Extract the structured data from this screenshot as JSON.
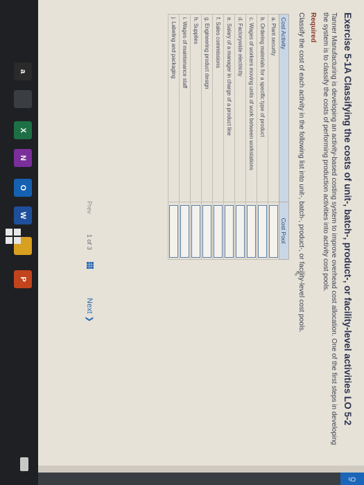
{
  "exercise": {
    "title": "Exercise 5-1A Classifying the costs of unit-, batch-, product-, or facility-level activities LO 5-2",
    "intro": "Tanner Manufacturing is developing an activity-based costing system to improve overhead cost allocation. One of the first steps in developing the system is to classify the costs of performing production activities into activity cost pools.",
    "required_label": "Required",
    "instruction": "Classify the cost of each activity in the following list into unit-, batch-, product-, or facility-level cost pools."
  },
  "table": {
    "headers": [
      "Cost Activity",
      "Cost Pool"
    ],
    "rows": [
      {
        "letter": "a.",
        "activity": "Plant security"
      },
      {
        "letter": "b.",
        "activity": "Ordering materials for a specific type of product"
      },
      {
        "letter": "c.",
        "activity": "Wages of workers moving units of work between workstations"
      },
      {
        "letter": "d.",
        "activity": "Factorywide electricity"
      },
      {
        "letter": "e.",
        "activity": "Salary of a manager in charge of a product line"
      },
      {
        "letter": "f.",
        "activity": "Sales commissions"
      },
      {
        "letter": "g.",
        "activity": "Engineering product design"
      },
      {
        "letter": "h.",
        "activity": "Supplies"
      },
      {
        "letter": "i.",
        "activity": "Wages of maintenance staff"
      },
      {
        "letter": "j.",
        "activity": "Labeling and packaging"
      }
    ]
  },
  "pager": {
    "prev_label": "Prev",
    "current": "1",
    "of_label": "of",
    "total": "3",
    "next_label": "Next"
  },
  "edge_tab": {
    "label": "Ch"
  },
  "taskbar": {
    "icons": [
      {
        "name": "amazon-icon",
        "label": "a",
        "color": "#2a2a2a"
      },
      {
        "name": "cloud-icon",
        "label": "",
        "color": "#3a3d42"
      },
      {
        "name": "excel-icon",
        "label": "X",
        "color": "#1d7044"
      },
      {
        "name": "onenote-icon",
        "label": "N",
        "color": "#7a2f9a"
      },
      {
        "name": "outlook-icon",
        "label": "O",
        "color": "#1560b0"
      },
      {
        "name": "word-icon",
        "label": "W",
        "color": "#1f4f9a"
      },
      {
        "name": "chrome-icon",
        "label": "",
        "color": "#d8a020"
      },
      {
        "name": "powerpoint-icon",
        "label": "P",
        "color": "#c2441c"
      }
    ]
  }
}
